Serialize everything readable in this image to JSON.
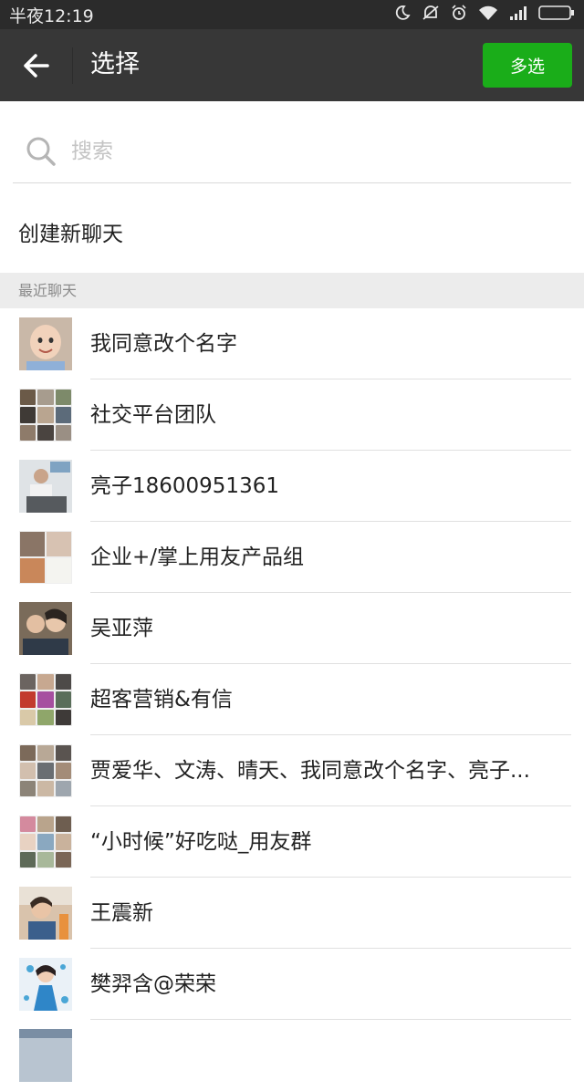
{
  "status_bar": {
    "time": "半夜12:19"
  },
  "header": {
    "title": "选择",
    "multi_select_label": "多选"
  },
  "search": {
    "placeholder": "搜索",
    "value": ""
  },
  "new_chat_label": "创建新聊天",
  "recent_section_label": "最近聊天",
  "chats": [
    {
      "name": "我同意改个名字"
    },
    {
      "name": "社交平台团队"
    },
    {
      "name": "亮子18600951361"
    },
    {
      "name": "企业+/掌上用友产品组"
    },
    {
      "name": "吴亚萍"
    },
    {
      "name": "超客营销&有信"
    },
    {
      "name": "贾爱华、文涛、晴天、我同意改个名字、亮子..."
    },
    {
      "name": "“小时候”好吃哒_用友群"
    },
    {
      "name": "王震新"
    },
    {
      "name": "樊羿含@荣荣"
    },
    {
      "name": ""
    }
  ],
  "colors": {
    "status_bar": "#2b2b2b",
    "title_bar": "#373737",
    "accent_green": "#1aad19",
    "section_bg": "#ececec"
  }
}
